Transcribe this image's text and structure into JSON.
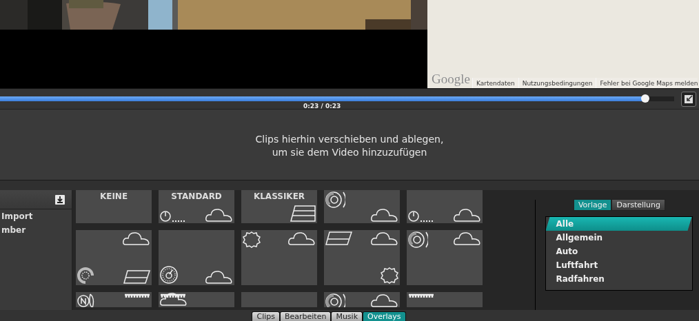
{
  "map": {
    "logo": "Google",
    "links": [
      "Kartendaten",
      "Nutzungsbedingungen",
      "Fehler bei Google Maps melden"
    ]
  },
  "player": {
    "level": 0.957,
    "time": "0:23 / 0:23"
  },
  "drop_zone": {
    "lines": [
      "Clips hierhin verschieben und ablegen,",
      "um sie dem Video hinzuzufügen"
    ]
  },
  "sidebar": {
    "items": [
      "Import",
      "mber"
    ]
  },
  "tiles": [
    {
      "kind": "labeled",
      "label": "KEINE"
    },
    {
      "kind": "labeled",
      "label": "STANDARD"
    },
    {
      "kind": "labeled",
      "label": "KLASSIKER"
    },
    {
      "kind": "preset"
    },
    {
      "kind": "preset"
    },
    {
      "kind": "preset"
    },
    {
      "kind": "preset"
    },
    {
      "kind": "preset"
    },
    {
      "kind": "preset"
    },
    {
      "kind": "preset"
    },
    {
      "kind": "preset"
    },
    {
      "kind": "preset"
    },
    {
      "kind": "preset"
    },
    {
      "kind": "preset"
    },
    {
      "kind": "preset"
    }
  ],
  "segments": [
    {
      "label": "Vorlage",
      "selected": true
    },
    {
      "label": "Darstellung",
      "selected": false
    }
  ],
  "categories": [
    {
      "label": "Alle",
      "selected": true
    },
    {
      "label": "Allgemein",
      "selected": false
    },
    {
      "label": "Auto",
      "selected": false
    },
    {
      "label": "Luftfahrt",
      "selected": false
    },
    {
      "label": "Radfahren",
      "selected": false
    }
  ],
  "tabs": [
    {
      "label": "Clips",
      "selected": false
    },
    {
      "label": "Bearbeiten",
      "selected": false
    },
    {
      "label": "Musik",
      "selected": false
    },
    {
      "label": "Overlays",
      "selected": true
    }
  ]
}
